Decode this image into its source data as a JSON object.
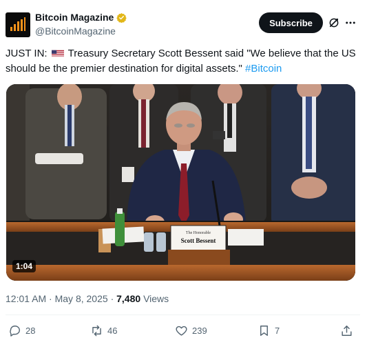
{
  "account": {
    "name": "Bitcoin Magazine",
    "handle": "@BitcoinMagazine",
    "verified_color": "#e2b719",
    "subscribe_label": "Subscribe"
  },
  "tweet": {
    "prefix": "JUST IN:",
    "flag_icon": "us-flag-icon",
    "body": "Treasury Secretary Scott Bessent said \"We believe that the US should be the premier destination for digital assets.\"",
    "hashtag": "#Bitcoin"
  },
  "video": {
    "duration": "1:04",
    "nameplate_small": "The Honorable",
    "nameplate_name": "Scott Bessent"
  },
  "meta": {
    "time": "12:01 AM",
    "separator1": "·",
    "date": "May 8, 2025",
    "separator2": "·",
    "views_count": "7,480",
    "views_label": "Views"
  },
  "actions": {
    "replies": "28",
    "reposts": "46",
    "likes": "239",
    "bookmarks": "7"
  },
  "colors": {
    "accent": "#1d9bf0",
    "text": "#0f1419",
    "muted": "#536471"
  }
}
